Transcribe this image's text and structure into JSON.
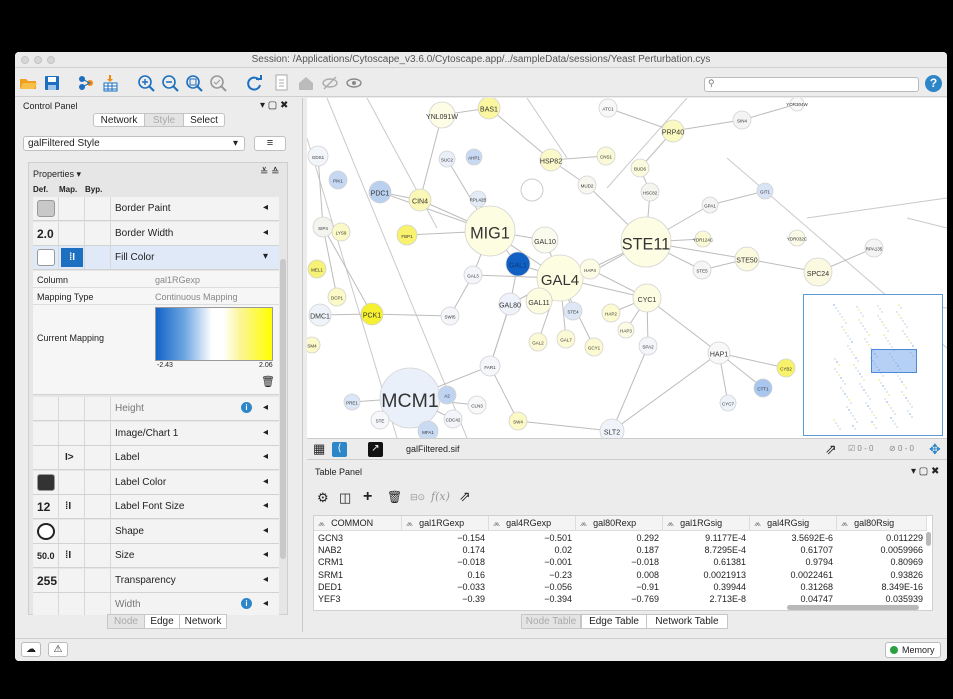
{
  "window": {
    "title": "Session: /Applications/Cytoscape_v3.6.0/Cytoscape.app/../sampleData/sessions/Yeast Perturbation.cys"
  },
  "control_panel": {
    "title": "Control Panel",
    "tabs": [
      "Network",
      "Style",
      "Select"
    ],
    "style_name": "galFiltered Style",
    "properties_label": "Properties",
    "col_heads": [
      "Def.",
      "Map.",
      "Byp."
    ],
    "rows_top": [
      {
        "label": "Border Paint",
        "def": "",
        "map": ""
      },
      {
        "label": "Border Width",
        "def": "2.0",
        "map": ""
      },
      {
        "label": "Fill Color",
        "def": "",
        "map": "⁞I"
      }
    ],
    "mapping": {
      "column_label": "Column",
      "column_value": "gal1RGexp",
      "type_label": "Mapping Type",
      "type_value": "Continuous Mapping",
      "current_label": "Current Mapping",
      "min": "-2.43",
      "max": "2.06"
    },
    "rows_bottom": [
      {
        "label": "Height",
        "def": "",
        "map": ""
      },
      {
        "label": "Image/Chart 1",
        "def": "",
        "map": ""
      },
      {
        "label": "Label",
        "def": "",
        "map": "I>"
      },
      {
        "label": "Label Color",
        "def": "",
        "map": ""
      },
      {
        "label": "Label Font Size",
        "def": "12",
        "map": "⁞I"
      },
      {
        "label": "Shape",
        "def": "",
        "map": ""
      },
      {
        "label": "Size",
        "def": "50.0",
        "map": "⁞I"
      },
      {
        "label": "Transparency",
        "def": "255",
        "map": ""
      },
      {
        "label": "Width",
        "def": "",
        "map": ""
      }
    ],
    "bottom_tabs": [
      "Node",
      "Edge",
      "Network"
    ]
  },
  "network_bar": {
    "filename": "galFiltered.sif",
    "count1": "0 - 0",
    "count2": "0 - 0"
  },
  "table_panel": {
    "title": "Table Panel",
    "columns": [
      "COMMON",
      "gal1RGexp",
      "gal4RGexp",
      "gal80Rexp",
      "gal1RGsig",
      "gal4RGsig",
      "gal80Rsig"
    ],
    "rows": [
      [
        "GCN3",
        "−0.154",
        "−0.501",
        "0.292",
        "9.1177E-4",
        "3.5692E-6",
        "0.011229"
      ],
      [
        "NAB2",
        "0.174",
        "0.02",
        "0.187",
        "8.7295E-4",
        "0.61707",
        "0.0059966"
      ],
      [
        "CRM1",
        "−0.018",
        "−0.001",
        "−0.018",
        "0.61381",
        "0.9794",
        "0.80969"
      ],
      [
        "SRM1",
        "0.16",
        "−0.23",
        "0.008",
        "0.0021913",
        "0.0022461",
        "0.93826"
      ],
      [
        "DED1",
        "−0.033",
        "−0.056",
        "−0.91",
        "0.39944",
        "0.31268",
        "8.349E-16"
      ],
      [
        "YEF3",
        "−0.39",
        "−0.394",
        "−0.769",
        "2.713E-8",
        "0.04747",
        "0.035939"
      ]
    ],
    "bottom_tabs": [
      "Node Table",
      "Edge Table",
      "Network Table"
    ]
  },
  "status": {
    "memory": "Memory"
  },
  "network": {
    "nodes": [
      {
        "n": "YNL091W",
        "c": "#fdfde6"
      },
      {
        "n": "BAS1",
        "c": "#fbf7a0"
      },
      {
        "n": "ATC1",
        "c": "#f8f8f8"
      },
      {
        "n": "YOR304W",
        "c": "#f8f8f8"
      },
      {
        "n": "SIN4",
        "c": "#f4f4f4"
      },
      {
        "n": "PRP40",
        "c": "#fbf9c2"
      },
      {
        "n": "GDS1",
        "c": "#f2f5fa"
      },
      {
        "n": "SUC2",
        "c": "#e9eff8"
      },
      {
        "n": "AHP1",
        "c": "#c8daf3"
      },
      {
        "n": "HSP82",
        "c": "#fbf9c9"
      },
      {
        "n": "CNS1",
        "c": "#fafad6"
      },
      {
        "n": "BUD6",
        "c": "#fafadc"
      },
      {
        "n": "MUD2",
        "c": "#f7f7f0"
      },
      {
        "n": "PIK1",
        "c": "#c5d7f2"
      },
      {
        "n": "PDC1",
        "c": "#b9d0ee"
      },
      {
        "n": "CIN4",
        "c": "#fbf7b6"
      },
      {
        "n": "RPL42B",
        "c": "#e3ebf7"
      },
      {
        "n": "HSC82",
        "c": "#f5f5f0"
      },
      {
        "n": "GPA1",
        "c": "#f4f4f4"
      },
      {
        "n": "GIT1",
        "c": "#d8e3f6"
      },
      {
        "n": "SIP4",
        "c": "#f4f4ee"
      },
      {
        "n": "LYS9",
        "c": "#fbf9c7"
      },
      {
        "n": "FBP1",
        "c": "#f8f26e"
      },
      {
        "n": "MIG1",
        "c": "#fdfde2"
      },
      {
        "n": "GAL10",
        "c": "#fbfbed"
      },
      {
        "n": "STE11",
        "c": "#fdfde4"
      },
      {
        "n": "YDR124C",
        "c": "#fbfad4"
      },
      {
        "n": "YDR032C",
        "c": "#fafae6"
      },
      {
        "n": "RPA135",
        "c": "#f4f4f4"
      },
      {
        "n": "MEL1",
        "c": "#f5f276"
      },
      {
        "n": "GAL3",
        "c": "#f4f5fa"
      },
      {
        "n": "GAL1",
        "c": "#1161c4"
      },
      {
        "n": "GAL4",
        "c": "#fdfde2"
      },
      {
        "n": "HAP4",
        "c": "#fcfce4"
      },
      {
        "n": "STE5",
        "c": "#f5f5f5"
      },
      {
        "n": "STE50",
        "c": "#fbfade"
      },
      {
        "n": "SPC24",
        "c": "#fbfae0"
      },
      {
        "n": "DCP1",
        "c": "#fbf9c6"
      },
      {
        "n": "DMC1",
        "c": "#eef3fa"
      },
      {
        "n": "PCK1",
        "c": "#f5f030"
      },
      {
        "n": "SWI5",
        "c": "#f4f6fa"
      },
      {
        "n": "GAL80",
        "c": "#eef2fa"
      },
      {
        "n": "GAL11",
        "c": "#fcfce0"
      },
      {
        "n": "STE4",
        "c": "#dde7f6"
      },
      {
        "n": "HAP2",
        "c": "#fbfad0"
      },
      {
        "n": "CYC1",
        "c": "#fcfce2"
      },
      {
        "n": "HAP3",
        "c": "#fcfbe4"
      },
      {
        "n": "SM4",
        "c": "#fbf9c8"
      },
      {
        "n": "GAL2",
        "c": "#fbfad5"
      },
      {
        "n": "GAL7",
        "c": "#fbfad5"
      },
      {
        "n": "GCY1",
        "c": "#fbfad0"
      },
      {
        "n": "SPA2",
        "c": "#f3f5fa"
      },
      {
        "n": "HAP1",
        "c": "#f8f8f8"
      },
      {
        "n": "CYB2",
        "c": "#f8f26a"
      },
      {
        "n": "FAR1",
        "c": "#f4f6fa"
      },
      {
        "n": "MCM1",
        "c": "#eaf0f9"
      },
      {
        "n": "PRE1",
        "c": "#dbe6f6"
      },
      {
        "n": "STE",
        "c": "#f5f7fb"
      },
      {
        "n": "A2",
        "c": "#c0d4f1"
      },
      {
        "n": "CLN3",
        "c": "#f7f8fa"
      },
      {
        "n": "CDC42",
        "c": "#f3f5fa"
      },
      {
        "n": "SW4",
        "c": "#fbf9c4"
      },
      {
        "n": "CTT1",
        "c": "#a9c6ee"
      },
      {
        "n": "CYC7",
        "c": "#eef3fa"
      },
      {
        "n": "SLT2",
        "c": "#f0f4fa"
      },
      {
        "n": "MFA1",
        "c": "#c9daf3"
      }
    ]
  }
}
